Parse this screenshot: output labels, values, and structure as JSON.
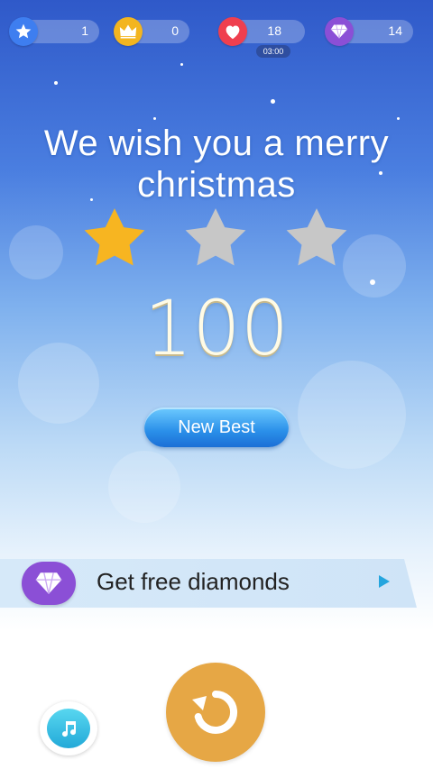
{
  "stats": {
    "stars": {
      "icon": "star-icon",
      "value": "1"
    },
    "crowns": {
      "icon": "crown-icon",
      "value": "0"
    },
    "lives": {
      "icon": "heart-icon",
      "value": "18",
      "timer": "03:00"
    },
    "diamonds": {
      "icon": "diamond-icon",
      "value": "14"
    }
  },
  "result": {
    "song_title": "We wish you a merry christmas",
    "stars_earned": 1,
    "stars_total": 3,
    "score": "100",
    "badge": "New Best"
  },
  "offer": {
    "label": "Get free diamonds",
    "icon": "diamond-icon"
  },
  "buttons": {
    "replay_icon": "replay-icon",
    "music_icon": "music-note-icon"
  },
  "colors": {
    "star_active": "#f7b521",
    "star_inactive": "#c7c7c7",
    "replay": "#e6a745",
    "diamond": "#8b4fd6",
    "badge": "#2a8fe9"
  }
}
